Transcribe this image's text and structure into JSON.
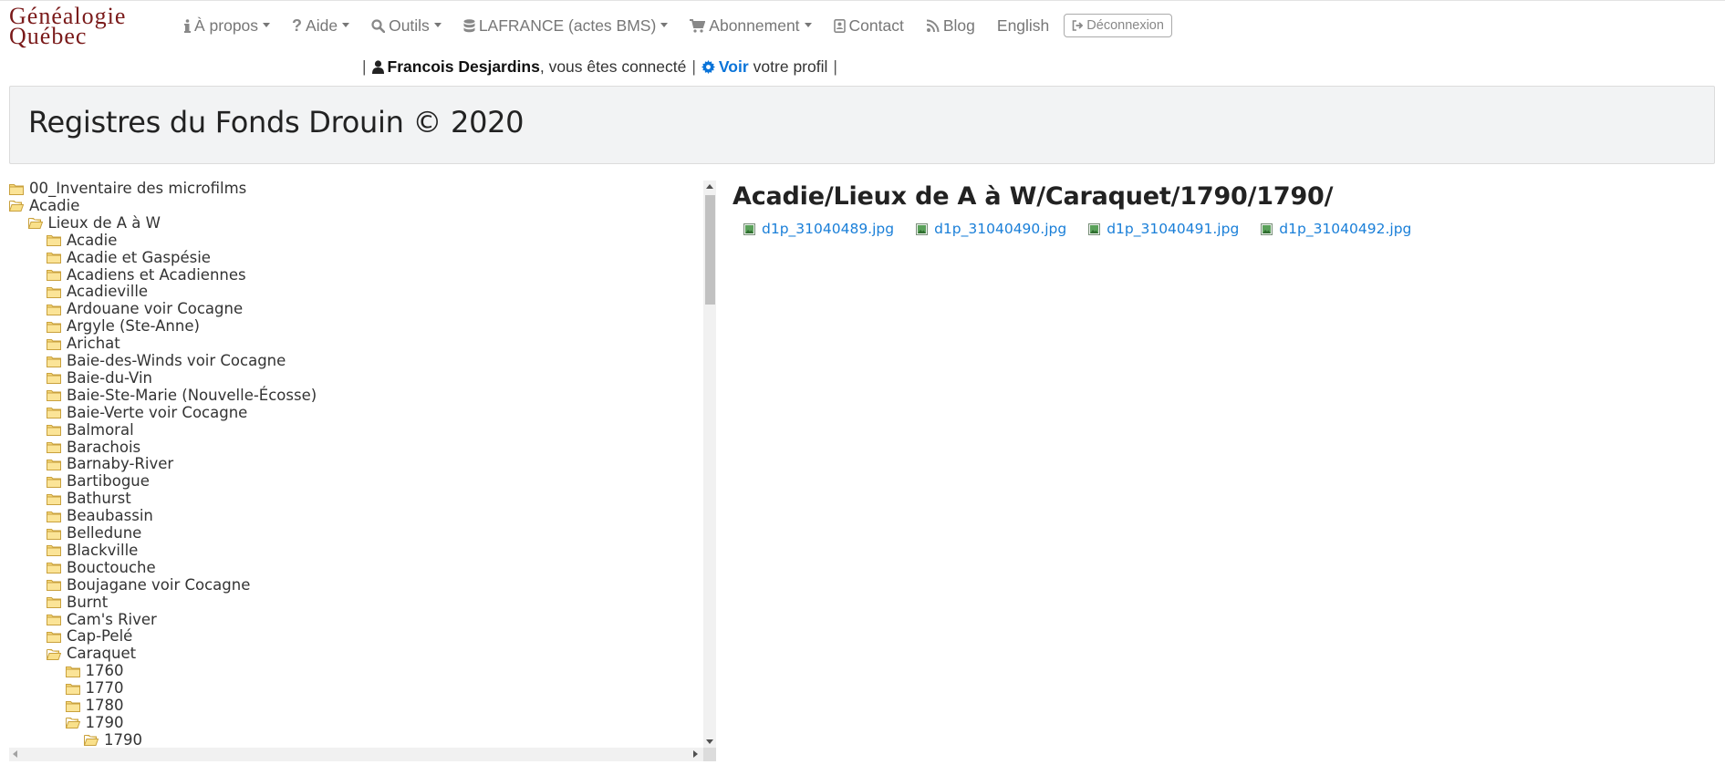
{
  "logo": {
    "line1": "Généalogie",
    "line2": "Québec"
  },
  "nav": {
    "items": [
      {
        "label": "À propos",
        "icon": "info-icon",
        "dropdown": true
      },
      {
        "label": "Aide",
        "icon": "question-icon",
        "dropdown": true
      },
      {
        "label": "Outils",
        "icon": "search-icon",
        "dropdown": true
      },
      {
        "label": "LAFRANCE (actes BMS)",
        "icon": "database-icon",
        "dropdown": true
      },
      {
        "label": "Abonnement",
        "icon": "cart-icon",
        "dropdown": true
      },
      {
        "label": "Contact",
        "icon": "address-book-icon",
        "dropdown": false
      },
      {
        "label": "Blog",
        "icon": "rss-icon",
        "dropdown": false
      },
      {
        "label": "English",
        "icon": "",
        "dropdown": false
      }
    ],
    "logout_label": "Déconnexion"
  },
  "userbar": {
    "pipe": "|",
    "user_name": "Francois Desjardins",
    "connected_text": ", vous êtes connecté",
    "voir_label": "Voir",
    "profile_text": "votre profil"
  },
  "page_title": "Registres du Fonds Drouin © 2020",
  "tree": {
    "nodes": [
      {
        "label": "00_Inventaire des microfilms",
        "level": 0,
        "type": "folder",
        "open": false
      },
      {
        "label": "Acadie",
        "level": 0,
        "type": "folder",
        "open": true
      },
      {
        "label": "Lieux de A à W",
        "level": 1,
        "type": "folder",
        "open": true
      },
      {
        "label": "Acadie",
        "level": 2,
        "type": "folder",
        "open": false
      },
      {
        "label": "Acadie et Gaspésie",
        "level": 2,
        "type": "folder",
        "open": false
      },
      {
        "label": "Acadiens et Acadiennes",
        "level": 2,
        "type": "folder",
        "open": false
      },
      {
        "label": "Acadieville",
        "level": 2,
        "type": "folder",
        "open": false
      },
      {
        "label": "Ardouane voir Cocagne",
        "level": 2,
        "type": "folder",
        "open": false
      },
      {
        "label": "Argyle (Ste-Anne)",
        "level": 2,
        "type": "folder",
        "open": false
      },
      {
        "label": "Arichat",
        "level": 2,
        "type": "folder",
        "open": false
      },
      {
        "label": "Baie-des-Winds voir Cocagne",
        "level": 2,
        "type": "folder",
        "open": false
      },
      {
        "label": "Baie-du-Vin",
        "level": 2,
        "type": "folder",
        "open": false
      },
      {
        "label": "Baie-Ste-Marie (Nouvelle-Écosse)",
        "level": 2,
        "type": "folder",
        "open": false
      },
      {
        "label": "Baie-Verte voir Cocagne",
        "level": 2,
        "type": "folder",
        "open": false
      },
      {
        "label": "Balmoral",
        "level": 2,
        "type": "folder",
        "open": false
      },
      {
        "label": "Barachois",
        "level": 2,
        "type": "folder",
        "open": false
      },
      {
        "label": "Barnaby-River",
        "level": 2,
        "type": "folder",
        "open": false
      },
      {
        "label": "Bartibogue",
        "level": 2,
        "type": "folder",
        "open": false
      },
      {
        "label": "Bathurst",
        "level": 2,
        "type": "folder",
        "open": false
      },
      {
        "label": "Beaubassin",
        "level": 2,
        "type": "folder",
        "open": false
      },
      {
        "label": "Belledune",
        "level": 2,
        "type": "folder",
        "open": false
      },
      {
        "label": "Blackville",
        "level": 2,
        "type": "folder",
        "open": false
      },
      {
        "label": "Bouctouche",
        "level": 2,
        "type": "folder",
        "open": false
      },
      {
        "label": "Boujagane voir Cocagne",
        "level": 2,
        "type": "folder",
        "open": false
      },
      {
        "label": "Burnt",
        "level": 2,
        "type": "folder",
        "open": false
      },
      {
        "label": "Cam's River",
        "level": 2,
        "type": "folder",
        "open": false
      },
      {
        "label": "Cap-Pelé",
        "level": 2,
        "type": "folder",
        "open": false
      },
      {
        "label": "Caraquet",
        "level": 2,
        "type": "folder",
        "open": true
      },
      {
        "label": "1760",
        "level": 3,
        "type": "folder",
        "open": false
      },
      {
        "label": "1770",
        "level": 3,
        "type": "folder",
        "open": false
      },
      {
        "label": "1780",
        "level": 3,
        "type": "folder",
        "open": false
      },
      {
        "label": "1790",
        "level": 3,
        "type": "folder",
        "open": true
      },
      {
        "label": "1790",
        "level": 4,
        "type": "folder",
        "open": true
      },
      {
        "label": "d1p_31040489.jpg",
        "level": 5,
        "type": "image",
        "open": false
      },
      {
        "label": "d1p_31040490.jpg",
        "level": 5,
        "type": "image",
        "open": false
      }
    ]
  },
  "content": {
    "path": "Acadie/Lieux de A à W/Caraquet/1790/1790/",
    "files": [
      "d1p_31040489.jpg",
      "d1p_31040490.jpg",
      "d1p_31040491.jpg",
      "d1p_31040492.jpg"
    ]
  }
}
